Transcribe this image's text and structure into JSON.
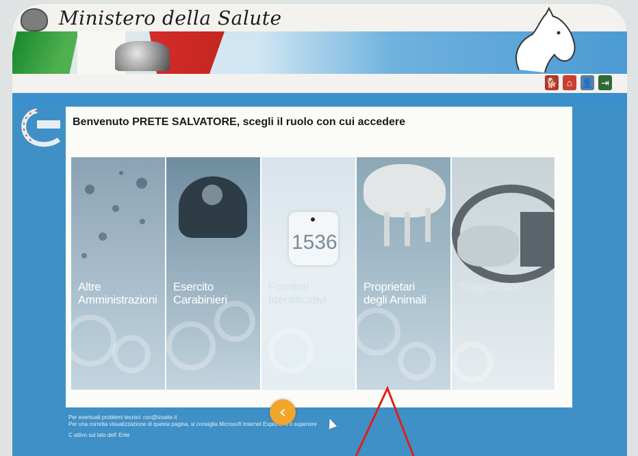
{
  "header": {
    "title": "Ministero della Salute",
    "icons": [
      "dog-icon",
      "home-icon",
      "user-icon",
      "exit-icon"
    ]
  },
  "main": {
    "welcome": "Benvenuto PRETE SALVATORE, scegli il ruolo con cui accedere",
    "roles": [
      {
        "line1": "Altre",
        "line2": "Amministrazioni"
      },
      {
        "line1": "Esercito",
        "line2": "Carabinieri"
      },
      {
        "line1": "Fornitori",
        "line2": "Identificativi"
      },
      {
        "line1": "Proprietari",
        "line2": "degli Animali"
      },
      {
        "line1": "Trasportatori",
        "line2": ""
      }
    ],
    "ear_tag_number": "1536",
    "prev_label": "‹"
  },
  "footer": {
    "line1": "Per eventuali problemi tecnici: csn@izsaite.it",
    "line2": "Per una corretta visualizzazione di questa pagina, si consiglia Microsoft Internet Explorer 8 o superiore",
    "line3": "C attivo sul lato dell' Ente"
  },
  "colors": {
    "page_blue": "#3f90c6",
    "accent_orange": "#f1a62b",
    "flag_green": "#1a8a2e",
    "flag_red": "#d32c2c"
  }
}
